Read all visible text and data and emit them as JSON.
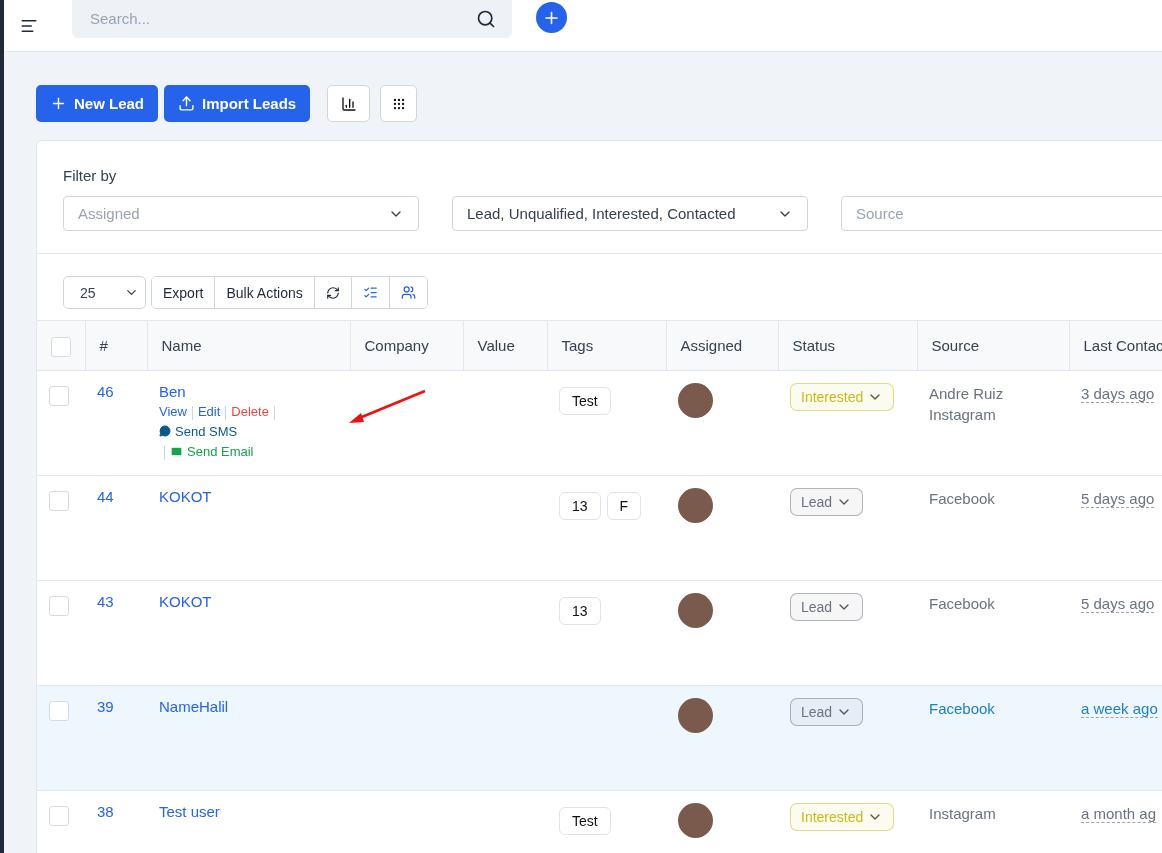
{
  "topbar": {
    "search": {
      "placeholder": "Search..."
    }
  },
  "actions": {
    "buttons": [
      {
        "label": "New Lead",
        "kind": "add"
      },
      {
        "label": "Import Leads",
        "kind": "upload"
      }
    ]
  },
  "filter": {
    "label": "Filter by",
    "fields": [
      {
        "placeholder": "Assigned"
      },
      {
        "value": "Lead, Unqualified, Interested, Contacted"
      },
      {
        "placeholder": "Source"
      }
    ]
  },
  "toolbar": {
    "page_size": "25",
    "buttons": [
      "Export",
      "Bulk Actions"
    ]
  },
  "table": {
    "select_all": {
      "checked": false
    },
    "columns": [
      "#",
      "Name",
      "Company",
      "Value",
      "Tags",
      "Assigned",
      "Status",
      "Source",
      "Last Contac"
    ],
    "rows": [
      {
        "id": "46",
        "name": "Ben",
        "actions": [
          {
            "label": "View",
            "kind": "view"
          },
          {
            "label": "Edit",
            "kind": "edit"
          },
          {
            "label": "Delete",
            "kind": "delete"
          },
          {
            "label": "Send SMS",
            "kind": "sms"
          },
          {
            "label": "Send Email",
            "kind": "email"
          }
        ],
        "tags": [
          "Test"
        ],
        "status": {
          "label": "Interested",
          "color": "#cabb14"
        },
        "source": [
          "Andre Ruiz",
          "Instagram"
        ],
        "last_contact": "3 days ago",
        "highlighted": false
      },
      {
        "id": "44",
        "name": "KOKOT",
        "tags": [
          "13",
          "F"
        ],
        "status": {
          "label": "Lead",
          "color": "#6b7280"
        },
        "source": [
          "Facebook"
        ],
        "last_contact": "5 days ago",
        "highlighted": false
      },
      {
        "id": "43",
        "name": "KOKOT",
        "tags": [
          "13"
        ],
        "status": {
          "label": "Lead",
          "color": "#6b7280"
        },
        "source": [
          "Facebook"
        ],
        "last_contact": "5 days ago",
        "highlighted": false
      },
      {
        "id": "39",
        "name": "NameHalil",
        "tags": [],
        "status": {
          "label": "Lead",
          "color": "#6b7280"
        },
        "source": [
          "Facebook"
        ],
        "last_contact": "a week ago",
        "highlighted": true
      },
      {
        "id": "38",
        "name": "Test user",
        "tags": [
          "Test"
        ],
        "status": {
          "label": "Interested",
          "color": "#cabb14"
        },
        "source": [
          "Instagram"
        ],
        "last_contact": "a month ag",
        "highlighted": false
      }
    ]
  }
}
